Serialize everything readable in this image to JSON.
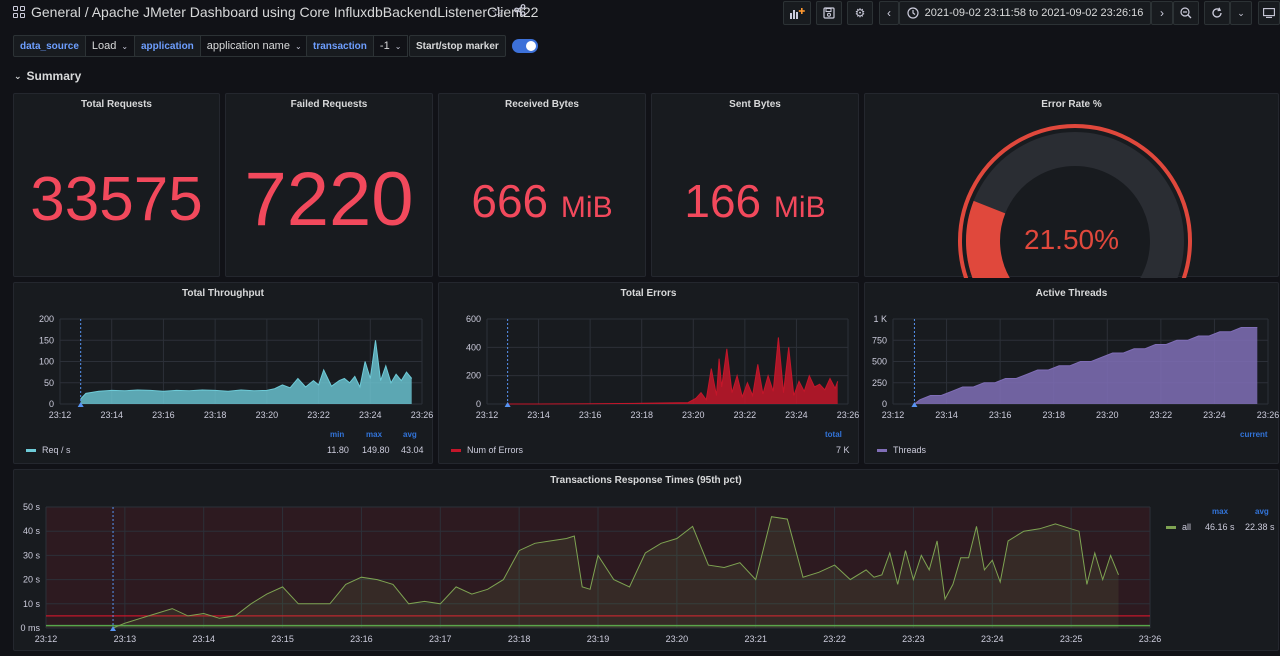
{
  "header": {
    "breadcrumb": "General  / Apache JMeter Dashboard using Core InfluxdbBackendListenerClient22",
    "time_range": "2021-09-02 23:11:58 to 2021-09-02 23:26:16",
    "icons": [
      "apps-icon",
      "star-icon",
      "share-icon",
      "add-panel-icon",
      "save-icon",
      "gear-icon",
      "chevron-left-icon",
      "clock-icon",
      "chevron-right-icon",
      "zoom-out-icon",
      "refresh-icon",
      "chevron-down-icon",
      "tv-icon"
    ]
  },
  "variables": {
    "data_source_label": "data_source",
    "data_source_value": "Load",
    "application_label": "application",
    "application_value": "application name",
    "transaction_label": "transaction",
    "transaction_value": "-1",
    "marker_label": "Start/stop marker",
    "marker_on": true
  },
  "row": {
    "title": "Summary"
  },
  "stats": {
    "total_requests": {
      "title": "Total Requests",
      "value": "33575"
    },
    "failed_requests": {
      "title": "Failed Requests",
      "value": "7220"
    },
    "received_bytes": {
      "title": "Received Bytes",
      "value": "666",
      "unit": "MiB"
    },
    "sent_bytes": {
      "title": "Sent Bytes",
      "value": "166",
      "unit": "MiB"
    },
    "error_rate": {
      "title": "Error Rate %",
      "value": "21.50%",
      "fraction": 0.215
    }
  },
  "colors": {
    "red": "#f2495c",
    "throughput": "#6ecbd8",
    "errors": "#c4162a",
    "threads": "#806eb7",
    "response": "#7ea352",
    "accent": "#3274d9"
  },
  "chart_data": [
    {
      "type": "area",
      "title": "Total Throughput",
      "x_ticks": [
        "23:12",
        "23:14",
        "23:16",
        "23:18",
        "23:20",
        "23:22",
        "23:24",
        "23:26"
      ],
      "y_ticks": [
        "200",
        "150",
        "100",
        "50",
        "0"
      ],
      "ylim": [
        0,
        200
      ],
      "series": [
        {
          "name": "Req / s",
          "x": [
            12.8,
            13.0,
            13.5,
            14.0,
            14.5,
            15.0,
            15.5,
            16.0,
            16.5,
            17.0,
            17.5,
            18.0,
            18.5,
            19.0,
            19.5,
            20.0,
            20.3,
            20.6,
            20.9,
            21.2,
            21.5,
            21.8,
            22.0,
            22.2,
            22.5,
            22.8,
            23.0,
            23.2,
            23.4,
            23.6,
            23.8,
            24.0,
            24.2,
            24.4,
            24.6,
            24.8,
            25.0,
            25.2,
            25.4,
            25.6
          ],
          "values": [
            12,
            25,
            30,
            32,
            31,
            33,
            32,
            30,
            32,
            31,
            33,
            32,
            30,
            33,
            31,
            32,
            36,
            45,
            38,
            60,
            40,
            55,
            45,
            80,
            42,
            55,
            60,
            50,
            65,
            40,
            100,
            60,
            150,
            55,
            90,
            50,
            70,
            55,
            75,
            60
          ]
        }
      ],
      "legend": {
        "label": "Req / s",
        "heads": [
          "min",
          "max",
          "avg"
        ],
        "values": [
          "11.80",
          "149.80",
          "43.04"
        ]
      }
    },
    {
      "type": "area",
      "title": "Total Errors",
      "x_ticks": [
        "23:12",
        "23:14",
        "23:16",
        "23:18",
        "23:20",
        "23:22",
        "23:24",
        "23:26"
      ],
      "y_ticks": [
        "600",
        "400",
        "200",
        "0"
      ],
      "ylim": [
        0,
        600
      ],
      "series": [
        {
          "name": "Num of Errors",
          "x": [
            12.8,
            14.0,
            16.0,
            18.0,
            19.8,
            20.1,
            20.3,
            20.5,
            20.7,
            20.9,
            21.0,
            21.1,
            21.3,
            21.5,
            21.7,
            21.9,
            22.1,
            22.3,
            22.5,
            22.7,
            22.9,
            23.1,
            23.3,
            23.5,
            23.7,
            23.9,
            24.1,
            24.3,
            24.5,
            24.7,
            24.9,
            25.1,
            25.3,
            25.5,
            25.6
          ],
          "values": [
            0,
            0,
            2,
            5,
            10,
            40,
            80,
            30,
            250,
            60,
            320,
            120,
            390,
            80,
            200,
            50,
            150,
            60,
            280,
            70,
            200,
            90,
            470,
            80,
            400,
            60,
            160,
            90,
            200,
            120,
            140,
            100,
            180,
            110,
            160
          ]
        }
      ],
      "legend": {
        "label": "Num of Errors",
        "heads": [
          "total"
        ],
        "values": [
          "7 K"
        ]
      }
    },
    {
      "type": "area",
      "title": "Active Threads",
      "x_ticks": [
        "23:12",
        "23:14",
        "23:16",
        "23:18",
        "23:20",
        "23:22",
        "23:24",
        "23:26"
      ],
      "y_ticks": [
        "1 K",
        "750",
        "500",
        "250",
        "0"
      ],
      "ylim": [
        0,
        1000
      ],
      "series": [
        {
          "name": "Threads",
          "x": [
            12.8,
            13.0,
            13.4,
            13.8,
            14.2,
            14.6,
            15.0,
            15.4,
            15.8,
            16.2,
            16.6,
            17.0,
            17.4,
            17.8,
            18.2,
            18.6,
            19.0,
            19.4,
            19.8,
            20.2,
            20.6,
            21.0,
            21.4,
            21.8,
            22.2,
            22.6,
            23.0,
            23.4,
            23.8,
            24.2,
            24.6,
            25.0,
            25.4,
            25.6
          ],
          "values": [
            0,
            50,
            100,
            100,
            150,
            200,
            200,
            250,
            250,
            300,
            300,
            350,
            400,
            400,
            450,
            450,
            500,
            500,
            550,
            600,
            600,
            650,
            650,
            700,
            700,
            750,
            750,
            800,
            800,
            850,
            850,
            900,
            900,
            900
          ]
        }
      ],
      "legend": {
        "label": "Threads",
        "heads": [
          "current"
        ],
        "values": [
          ""
        ]
      }
    },
    {
      "type": "line",
      "title": "Transactions Response Times (95th pct)",
      "x_ticks": [
        "23:12",
        "23:13",
        "23:14",
        "23:15",
        "23:16",
        "23:17",
        "23:18",
        "23:19",
        "23:20",
        "23:21",
        "23:22",
        "23:23",
        "23:24",
        "23:25",
        "23:26"
      ],
      "y_ticks": [
        "50 s",
        "40 s",
        "30 s",
        "20 s",
        "10 s",
        "0 ms"
      ],
      "ylim": [
        0,
        50
      ],
      "series": [
        {
          "name": "all",
          "x": [
            12.85,
            13.0,
            13.2,
            13.4,
            13.6,
            13.8,
            14.0,
            14.2,
            14.4,
            14.6,
            14.8,
            15.0,
            15.2,
            15.4,
            15.6,
            15.8,
            16.0,
            16.2,
            16.4,
            16.6,
            16.8,
            17.0,
            17.2,
            17.4,
            17.6,
            17.8,
            18.0,
            18.2,
            18.4,
            18.6,
            18.7,
            18.8,
            18.9,
            19.0,
            19.2,
            19.4,
            19.6,
            19.8,
            20.0,
            20.2,
            20.4,
            20.6,
            20.8,
            21.0,
            21.2,
            21.4,
            21.6,
            21.8,
            22.0,
            22.2,
            22.4,
            22.5,
            22.6,
            22.7,
            22.8,
            22.9,
            23.0,
            23.1,
            23.2,
            23.3,
            23.4,
            23.5,
            23.6,
            23.7,
            23.8,
            23.9,
            24.0,
            24.1,
            24.2,
            24.4,
            24.6,
            24.8,
            25.0,
            25.1,
            25.2,
            25.3,
            25.4,
            25.5,
            25.6
          ],
          "values": [
            0,
            2,
            4,
            6,
            8,
            5,
            6,
            4,
            5,
            10,
            14,
            17,
            10,
            10,
            10,
            18,
            21,
            20,
            18,
            10,
            11,
            10,
            17,
            14,
            16,
            20,
            32,
            35,
            36,
            37,
            38,
            17,
            16,
            30,
            20,
            17,
            31,
            35,
            37,
            42,
            26,
            25,
            27,
            20,
            46,
            45,
            21,
            23,
            26,
            20,
            24,
            21,
            22,
            31,
            18,
            32,
            20,
            30,
            24,
            36,
            12,
            18,
            29,
            29,
            42,
            24,
            28,
            19,
            36,
            40,
            41,
            43,
            41,
            40,
            18,
            31,
            20,
            30,
            22
          ]
        }
      ],
      "thresholds": [
        5,
        1
      ],
      "legend": {
        "label": "all",
        "heads": [
          "max",
          "avg"
        ],
        "values": [
          "46.16 s",
          "22.38 s"
        ]
      }
    }
  ]
}
